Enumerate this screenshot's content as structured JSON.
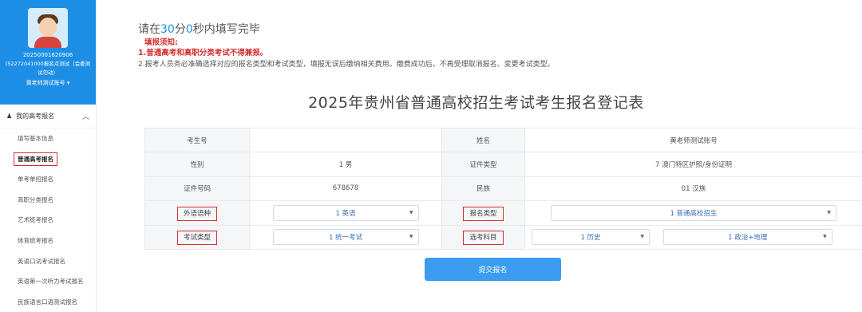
{
  "profile": {
    "id": "20250001620906",
    "note": "(52272041000报名点测试（会委测试勿动）",
    "account": "黄老师测试账号 ▾"
  },
  "menu": {
    "section": "我的高考报名",
    "items": [
      {
        "label": "填写基本信息"
      },
      {
        "label": "普通高考报名"
      },
      {
        "label": "单考单招报名"
      },
      {
        "label": "高职分类报名"
      },
      {
        "label": "艺术统考报名"
      },
      {
        "label": "体育统考报名"
      },
      {
        "label": "英语口试考试报名"
      },
      {
        "label": "英语第一次听力考试报名"
      },
      {
        "label": "民族语言口语测试报名"
      }
    ]
  },
  "timer": {
    "prefix": "请在",
    "minutes": "30",
    "mid": "分",
    "seconds": "0",
    "suffix": "秒内填写完毕"
  },
  "notice": {
    "title": "填报须知:",
    "line1": "1.普通高考和高职分类考试不得兼报。",
    "line2": "2.报考人员务必准确选择对应的报名类型和考试类型，填报无误后缴纳相关费用。缴费成功后，不再受理取消报名、变更考试类型。"
  },
  "form": {
    "title": "2025年贵州省普通高校招生考试考生报名登记表",
    "rows": {
      "exam_no_label": "考生号",
      "exam_no_value": "",
      "name_label": "姓名",
      "name_value": "黄老师测试账号",
      "gender_label": "性别",
      "gender_value": "1 男",
      "idtype_label": "证件类型",
      "idtype_value": "7 澳门特区护照/身份证明",
      "idno_label": "证件号码",
      "idno_value": "678678",
      "ethnic_label": "民族",
      "ethnic_value": "01 汉族",
      "lang_label": "外语语种",
      "lang_value": "1 英语",
      "regtype_label": "报名类型",
      "regtype_value": "1 普通高校招生",
      "examtype_label": "考试类型",
      "examtype_value": "1 统一考试",
      "subject_label": "选考科目",
      "subject1_value": "1 历史",
      "subject2_value": "1 政治+地理"
    },
    "submit_label": "提交报名"
  }
}
